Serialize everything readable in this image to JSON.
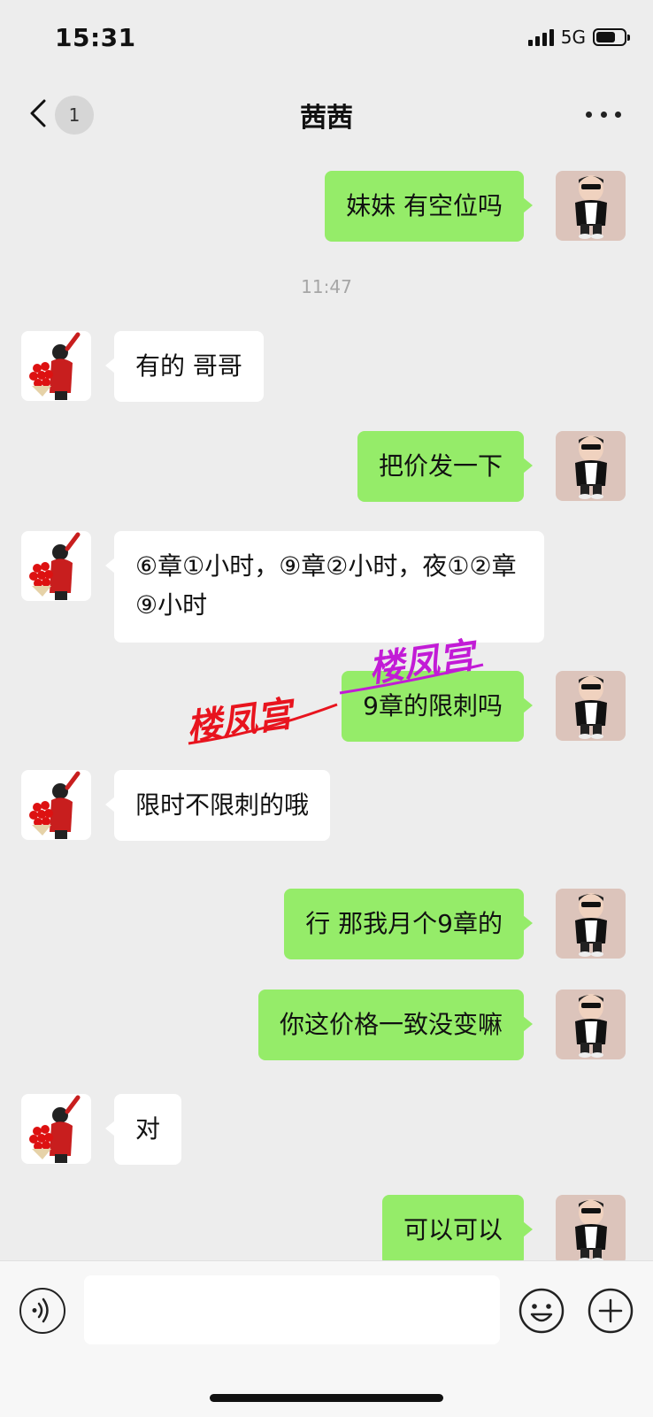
{
  "status_bar": {
    "time": "15:31",
    "network": "5G",
    "battery_level": 0.7
  },
  "header": {
    "title": "茜茜",
    "unread_count": "1"
  },
  "messages": [
    {
      "side": "self",
      "text": "妹妹 有空位吗"
    },
    {
      "type": "timestamp",
      "text": "11:47"
    },
    {
      "side": "peer",
      "text": "有的 哥哥"
    },
    {
      "side": "self",
      "text": "把价发一下"
    },
    {
      "side": "peer",
      "text": "⑥章①小时，⑨章②小时，夜①②章⑨小时"
    },
    {
      "side": "self",
      "text": "9章的限刺吗"
    },
    {
      "side": "peer",
      "text": "限时不限刺的哦"
    },
    {
      "side": "self",
      "text": "行 那我月个9章的"
    },
    {
      "side": "self",
      "text": "你这价格一致没变嘛"
    },
    {
      "side": "peer",
      "text": "对"
    },
    {
      "side": "self",
      "text": "可以可以"
    }
  ],
  "watermarks": [
    {
      "text": "楼凤宫",
      "color": "#e8141e"
    },
    {
      "text": "楼凤宫",
      "color": "#c21bd6"
    }
  ],
  "input_bar": {
    "value": "",
    "placeholder": ""
  },
  "icons": [
    "back-icon",
    "more-icon",
    "voice-icon",
    "emoji-icon",
    "plus-icon"
  ]
}
